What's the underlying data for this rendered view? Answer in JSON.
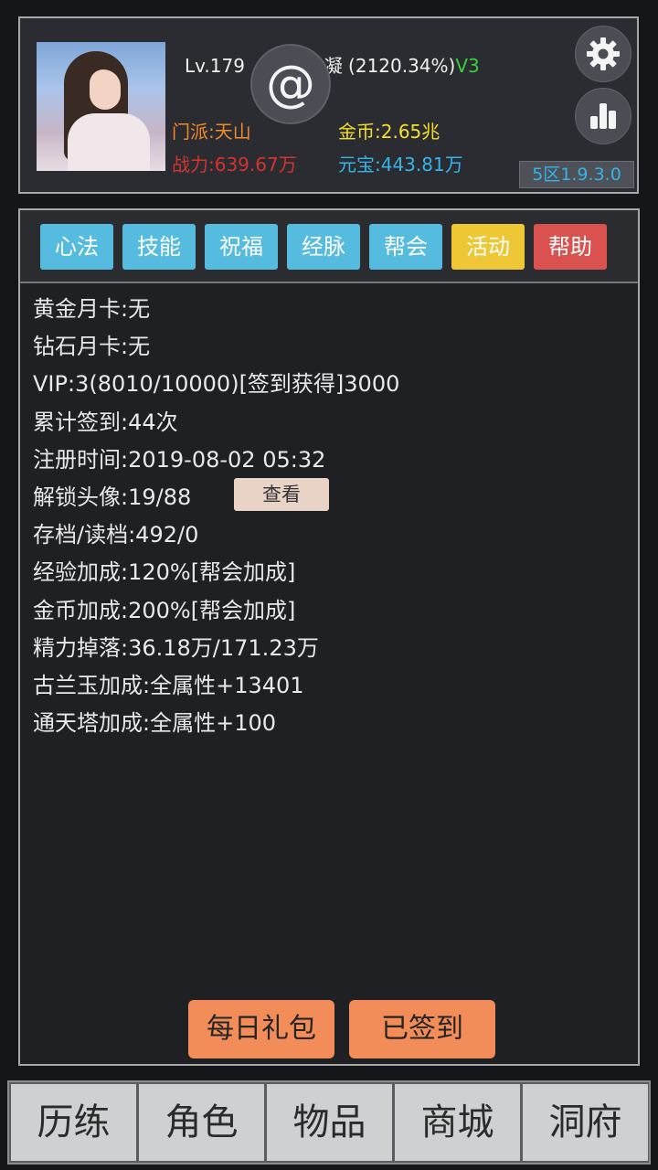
{
  "header": {
    "level_text": "Lv.179",
    "name_char": "凝",
    "exp_percent": "(2120.34%)",
    "vip_badge": "V3",
    "at_icon": "@",
    "sect": "门派:天山",
    "gold": "金币:2.65兆",
    "power": "战力:639.67万",
    "ingot": "元宝:443.81万",
    "version": "5区1.9.3.0",
    "icons": {
      "settings": "gear-icon",
      "stats": "bar-chart-icon"
    }
  },
  "tabs": [
    {
      "label": "心法",
      "color": "#55bce0"
    },
    {
      "label": "技能",
      "color": "#55bce0"
    },
    {
      "label": "祝福",
      "color": "#55bce0"
    },
    {
      "label": "经脉",
      "color": "#55bce0"
    },
    {
      "label": "帮会",
      "color": "#55bce0"
    },
    {
      "label": "活动",
      "color": "#edc735"
    },
    {
      "label": "帮助",
      "color": "#d9524f"
    }
  ],
  "info": [
    "黄金月卡:无",
    "钻石月卡:无",
    "VIP:3(8010/10000)[签到获得]3000",
    "累计签到:44次",
    "注册时间:2019-08-02 05:32",
    "解锁头像:19/88",
    "存档/读档:492/0",
    "经验加成:120%[帮会加成]",
    "金币加成:200%[帮会加成]",
    "精力掉落:36.18万/171.23万",
    "古兰玉加成:全属性+13401",
    "通天塔加成:全属性+100"
  ],
  "view_button": "查看",
  "daily_gift_button": "每日礼包",
  "signed_button": "已签到",
  "nav": [
    "历练",
    "角色",
    "物品",
    "商城",
    "洞府"
  ]
}
